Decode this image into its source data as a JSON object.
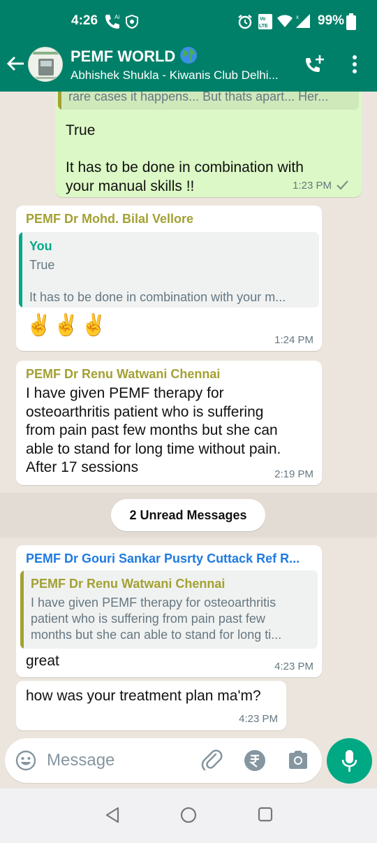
{
  "status_bar": {
    "time": "4:26",
    "battery": "99%"
  },
  "header": {
    "title": "PEMF WORLD",
    "subtitle": "Abhishek Shukla - Kiwanis Club Delhi...",
    "icons": [
      "back-arrow-icon",
      "add-call-icon",
      "more-vert-icon"
    ]
  },
  "messages": [
    {
      "direction": "out",
      "quote_text": "rare cases it happens... But thats apart... Her...",
      "text_lines": [
        "True",
        "",
        "It has to be done in combination with",
        "your manual skills !!"
      ],
      "time": "1:23 PM"
    },
    {
      "direction": "in",
      "sender": "PEMF Dr Mohd. Bilal Vellore",
      "quote": {
        "name": "You",
        "line1": "True",
        "line2": "It has to be done in combination with your m..."
      },
      "text": "✌️✌️✌️",
      "time": "1:24 PM"
    },
    {
      "direction": "in",
      "sender": "PEMF Dr Renu Watwani Chennai",
      "text_lines": [
        "I have given PEMF therapy for",
        "osteoarthritis patient who is suffering",
        "from pain past few months but she can",
        "able to stand for long time without pain.",
        "After 17 sessions"
      ],
      "time": "2:19 PM"
    },
    {
      "direction": "in",
      "sender": "PEMF Dr Gouri Sankar Pusrty Cuttack Ref R...",
      "quote": {
        "name": "PEMF Dr Renu Watwani Chennai",
        "lines": [
          "I have given PEMF therapy for osteoarthritis",
          "patient who is suffering from pain past few",
          "months but she can able to stand for long ti..."
        ]
      },
      "text": "great",
      "time": "4:23 PM"
    },
    {
      "direction": "in",
      "text": "how was your treatment plan ma'm?",
      "time": "4:23 PM"
    }
  ],
  "unread_label": "2 Unread Messages",
  "composer": {
    "placeholder": "Message"
  },
  "colors": {
    "header": "#008069",
    "outgoing_bubble": "#dcf8c6",
    "incoming_bubble": "#ffffff",
    "sender_olive": "#a3a133",
    "sender_blue": "#1f7ae0",
    "you_green": "#06a88a",
    "mic": "#00a884"
  }
}
